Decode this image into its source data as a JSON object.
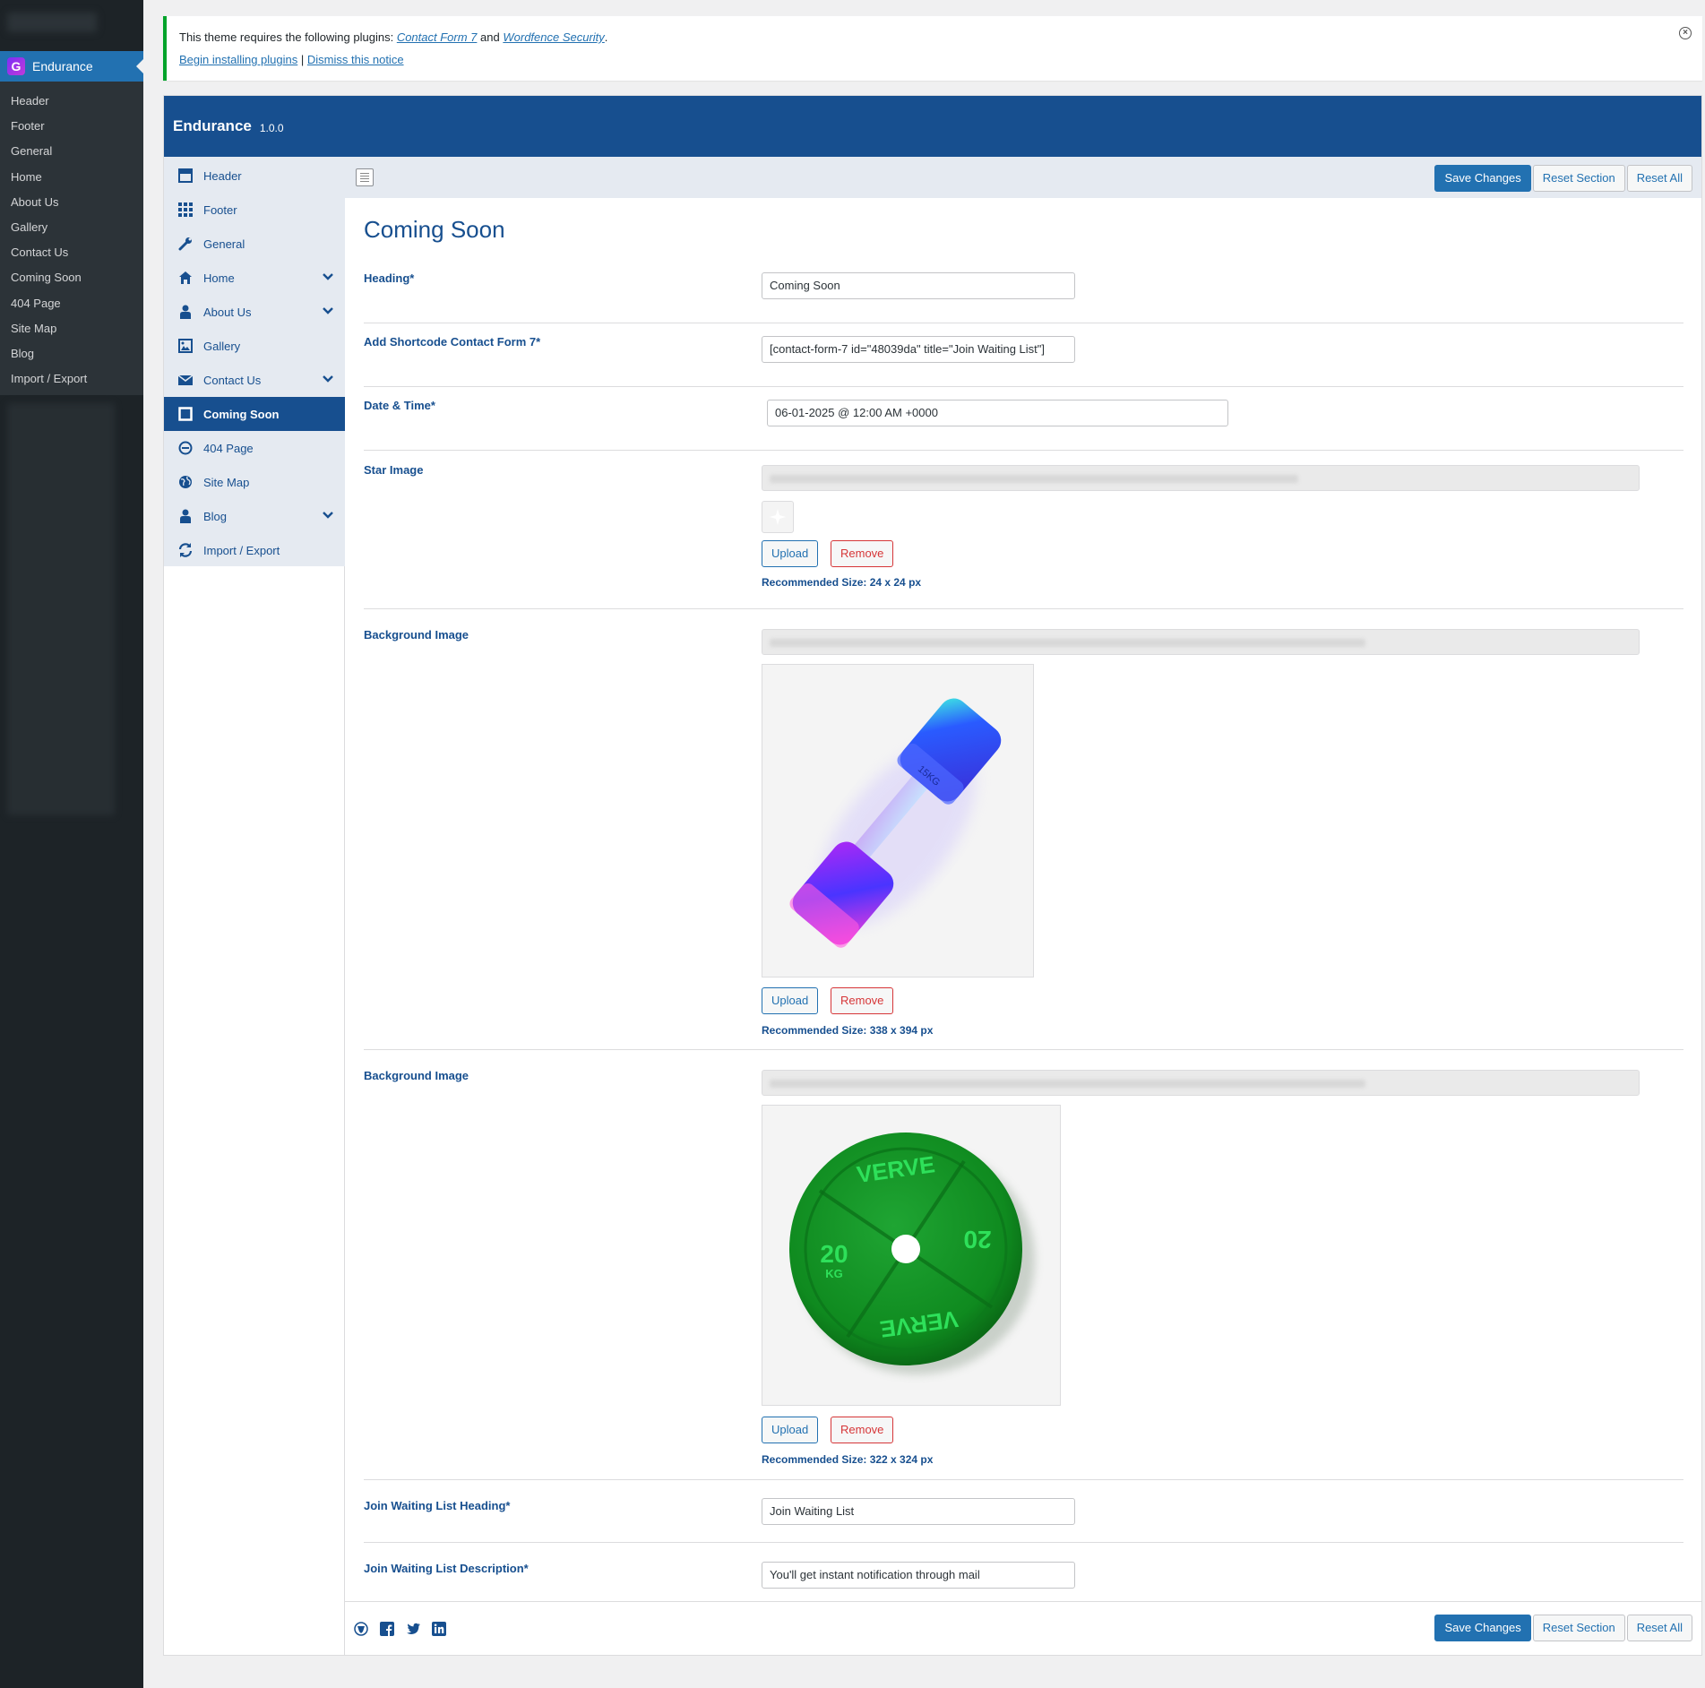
{
  "wp_menu": {
    "current": "Endurance",
    "submenu": [
      "Header",
      "Footer",
      "General",
      "Home",
      "About Us",
      "Gallery",
      "Contact Us",
      "Coming Soon",
      "404 Page",
      "Site Map",
      "Blog",
      "Import / Export"
    ]
  },
  "notice": {
    "text": "This theme requires the following plugins:",
    "plugin1": "Contact Form 7",
    "and": "and",
    "plugin2": "Wordfence Security",
    "period": ".",
    "begin_link": "Begin installing plugins",
    "separator": "|",
    "dismiss_link": "Dismiss this notice"
  },
  "panel": {
    "title": "Endurance",
    "version": "1.0.0"
  },
  "nav": [
    {
      "label": "Header",
      "icon": "header-icon",
      "chevron": false
    },
    {
      "label": "Footer",
      "icon": "grid-icon",
      "chevron": false
    },
    {
      "label": "General",
      "icon": "wrench-icon",
      "chevron": false
    },
    {
      "label": "Home",
      "icon": "home-icon",
      "chevron": true
    },
    {
      "label": "About Us",
      "icon": "person-icon",
      "chevron": true
    },
    {
      "label": "Gallery",
      "icon": "image-icon",
      "chevron": false
    },
    {
      "label": "Contact Us",
      "icon": "envelope-icon",
      "chevron": true
    },
    {
      "label": "Coming Soon",
      "icon": "square-icon",
      "chevron": false,
      "active": true
    },
    {
      "label": "404 Page",
      "icon": "minus-circle-icon",
      "chevron": false
    },
    {
      "label": "Site Map",
      "icon": "globe-icon",
      "chevron": false
    },
    {
      "label": "Blog",
      "icon": "person-icon",
      "chevron": true
    },
    {
      "label": "Import / Export",
      "icon": "refresh-icon",
      "chevron": false
    }
  ],
  "toolbar": {
    "save": "Save Changes",
    "reset_section": "Reset Section",
    "reset_all": "Reset All"
  },
  "section": {
    "title": "Coming Soon",
    "heading_label": "Heading*",
    "heading_value": "Coming Soon",
    "shortcode_label": "Add Shortcode Contact Form 7*",
    "shortcode_value": "[contact-form-7 id=\"48039da\" title=\"Join Waiting List\"]",
    "datetime_label": "Date & Time*",
    "datetime_value": "06-01-2025 @ 12:00 AM +0000",
    "star_label": "Star Image",
    "star_rec": "Recommended Size: 24 x 24 px",
    "bg1_label": "Background Image",
    "bg1_rec": "Recommended Size: 338 x 394 px",
    "bg2_label": "Background Image",
    "bg2_rec": "Recommended Size: 322 x 324 px",
    "plate_text_top": "VERVE",
    "plate_text_bottom": "VERVE",
    "plate_weight": "20",
    "plate_unit": "KG",
    "dumbbell_weight": "15KG",
    "join_heading_label": "Join Waiting List Heading*",
    "join_heading_value": "Join Waiting List",
    "join_desc_label": "Join Waiting List Description*",
    "join_desc_value": "You'll get instant notification through mail",
    "upload": "Upload",
    "remove": "Remove"
  },
  "colors": {
    "brand": "#174f8f",
    "accent": "#2271b1",
    "notice_border": "#00a32a",
    "remove": "#d63638"
  }
}
